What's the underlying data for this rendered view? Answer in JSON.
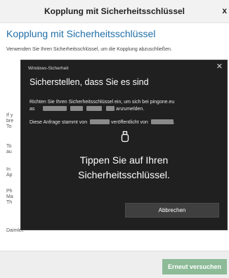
{
  "topbar": {
    "title": "Kopplung mit Sicherheitsschlüssel",
    "close_glyph": "x"
  },
  "page": {
    "heading": "Kopplung mit Sicherheitsschlüssel",
    "intro": "Verwenden Sie Ihren Sicherheitsschlüssel, um die Kopplung abzuschließen.",
    "fragments": [
      "If y",
      "bre",
      "To",
      "To",
      "au",
      "In",
      "Ap",
      "Ph",
      "Ma",
      "Th",
      "Daimler."
    ]
  },
  "dialog": {
    "header": "Windows-Sicherheit",
    "close_glyph": "✕",
    "title": "Sicherstellen, dass Sie es sind",
    "line1": "Richten Sie Ihren Sicherheitsschlüssel ein, um sich bei pingone.eu",
    "line2_prefix": "as",
    "line2_suffix": "anzumelden.",
    "line3_prefix": "Diese Anfrage stammt von",
    "line3_mid": "veröffentlicht von",
    "line3_end": ".",
    "tap_line1": "Tippen Sie auf Ihren",
    "tap_line2": "Sicherheitsschlüssel.",
    "cancel": "Abbrechen",
    "icon": "security-key-icon"
  },
  "footer": {
    "retry": "Erneut versuchen"
  },
  "colors": {
    "accent": "#1f6fa8",
    "retry_bg": "#8dbb98",
    "dialog_bg": "#202020"
  }
}
